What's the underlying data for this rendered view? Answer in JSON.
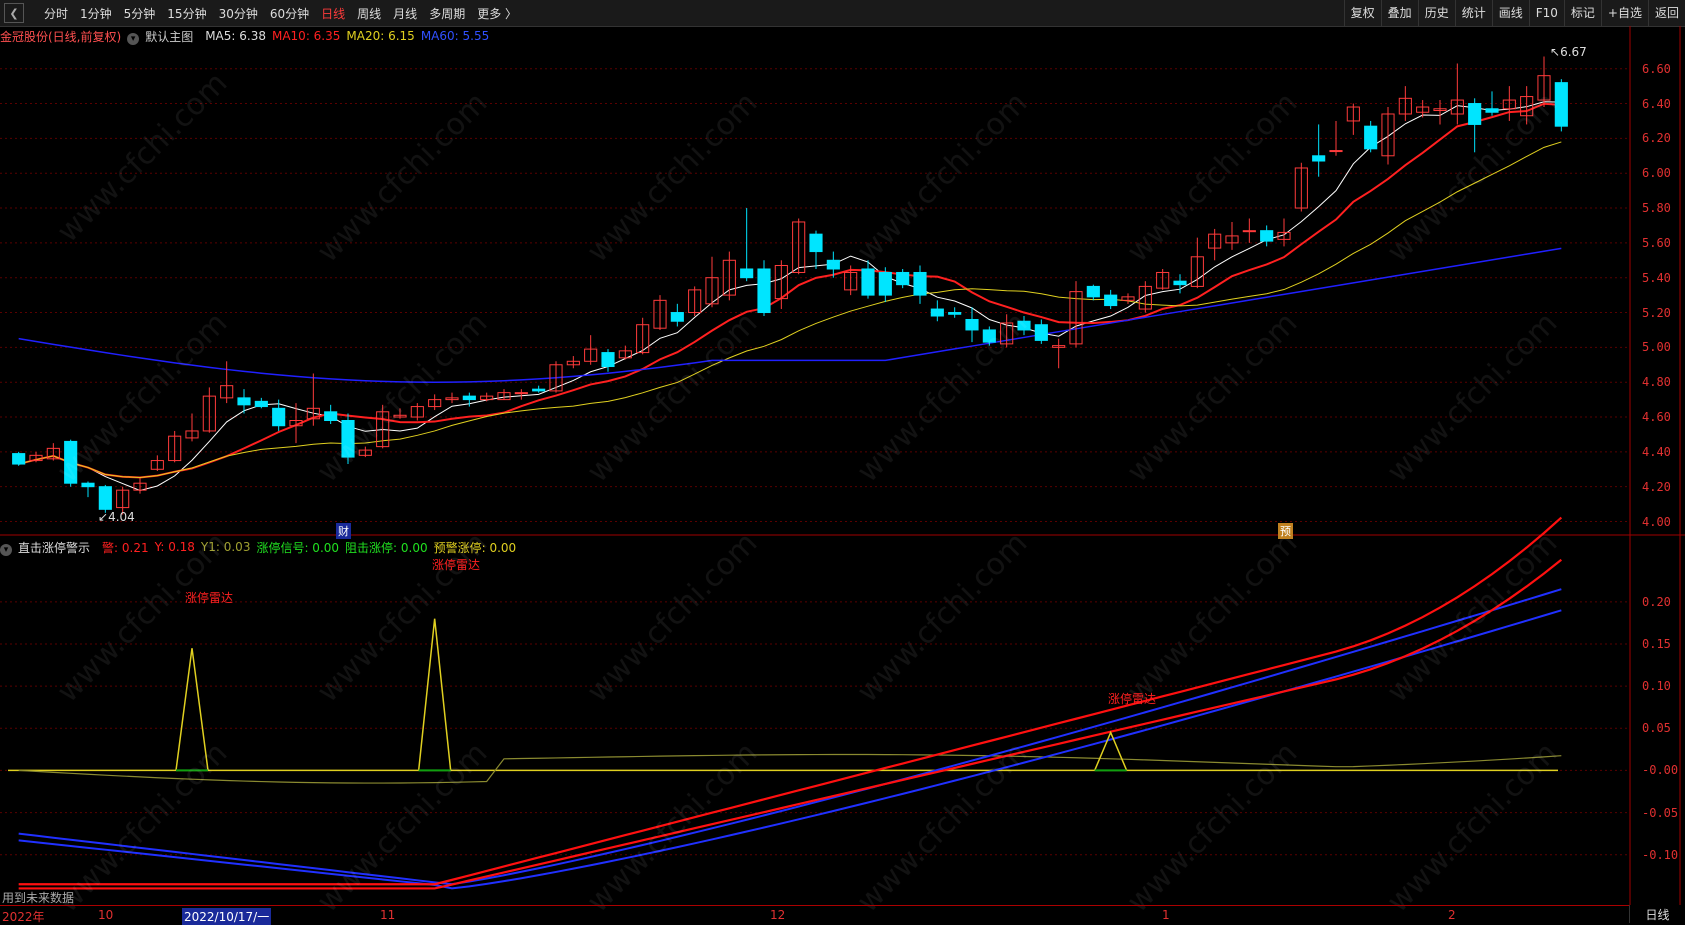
{
  "toolbar": {
    "periods": [
      "分时",
      "1分钟",
      "5分钟",
      "15分钟",
      "30分钟",
      "60分钟",
      "日线",
      "周线",
      "月线",
      "多周期",
      "更多 〉"
    ],
    "active_period": "日线",
    "right_buttons": [
      "复权",
      "叠加",
      "历史",
      "统计",
      "画线",
      "F10",
      "标记",
      "+自选",
      "返回"
    ]
  },
  "main_chart": {
    "stock_title": "金冠股份(日线,前复权)",
    "template": "默认主图",
    "ma5": "MA5: 6.38",
    "ma10": "MA10: 6.35",
    "ma20": "MA20: 6.15",
    "ma60": "MA60: 5.55",
    "high_label": "6.67",
    "low_label": "4.04",
    "marker_cai": "财",
    "marker_yu": "预",
    "y_ticks": [
      "6.60",
      "6.40",
      "6.20",
      "6.00",
      "5.80",
      "5.60",
      "5.40",
      "5.20",
      "5.00",
      "4.80",
      "4.60",
      "4.40",
      "4.20",
      "4.00"
    ]
  },
  "indicator": {
    "name": "直击涨停警示",
    "jing": "警: 0.21",
    "y": "Y: 0.18",
    "y1": "Y1: 0.03",
    "signal": "涨停信号: 0.00",
    "zuji": "阻击涨停: 0.00",
    "yujing": "预警涨停: 0.00",
    "radar_labels": [
      "涨停雷达",
      "涨停雷达",
      "涨停雷达"
    ],
    "y_ticks": [
      "0.20",
      "0.15",
      "0.10",
      "0.05",
      "-0.00",
      "-0.05",
      "-0.10"
    ]
  },
  "date_axis": {
    "labels": [
      "2022年",
      "10",
      "2022/10/17/一",
      "11",
      "12",
      "1",
      "2"
    ],
    "period": "日线"
  },
  "footer_note": "用到未来数据",
  "watermark": "www.cfchi.com",
  "colors": {
    "up": "#ff3b3b",
    "down": "#00e5ff",
    "ma5": "#ffffff",
    "ma10": "#ff2020",
    "ma20": "#e0d020",
    "ma60": "#2020ff"
  },
  "chart_data": {
    "type": "candlestick",
    "price_range": [
      3.95,
      6.7
    ],
    "candles": [
      [
        4.39,
        4.33,
        4.4,
        4.32
      ],
      [
        4.35,
        4.38,
        4.4,
        4.34
      ],
      [
        4.36,
        4.42,
        4.45,
        4.35
      ],
      [
        4.46,
        4.22,
        4.47,
        4.2
      ],
      [
        4.22,
        4.2,
        4.23,
        4.14
      ],
      [
        4.2,
        4.07,
        4.21,
        4.05
      ],
      [
        4.08,
        4.18,
        4.2,
        4.04
      ],
      [
        4.18,
        4.22,
        4.25,
        4.16
      ],
      [
        4.3,
        4.35,
        4.38,
        4.29
      ],
      [
        4.35,
        4.49,
        4.52,
        4.34
      ],
      [
        4.48,
        4.52,
        4.62,
        4.46
      ],
      [
        4.52,
        4.72,
        4.77,
        4.51
      ],
      [
        4.71,
        4.78,
        4.92,
        4.68
      ],
      [
        4.71,
        4.67,
        4.76,
        4.62
      ],
      [
        4.69,
        4.66,
        4.71,
        4.65
      ],
      [
        4.65,
        4.55,
        4.7,
        4.52
      ],
      [
        4.55,
        4.58,
        4.68,
        4.45
      ],
      [
        4.59,
        4.65,
        4.85,
        4.55
      ],
      [
        4.63,
        4.58,
        4.67,
        4.56
      ],
      [
        4.58,
        4.37,
        4.62,
        4.33
      ],
      [
        4.38,
        4.41,
        4.43,
        4.37
      ],
      [
        4.43,
        4.63,
        4.67,
        4.42
      ],
      [
        4.6,
        4.61,
        4.65,
        4.59
      ],
      [
        4.6,
        4.66,
        4.68,
        4.58
      ],
      [
        4.66,
        4.7,
        4.73,
        4.64
      ],
      [
        4.7,
        4.71,
        4.74,
        4.68
      ],
      [
        4.72,
        4.7,
        4.74,
        4.66
      ],
      [
        4.7,
        4.72,
        4.74,
        4.69
      ],
      [
        4.7,
        4.74,
        4.76,
        4.7
      ],
      [
        4.74,
        4.74,
        4.76,
        4.7
      ],
      [
        4.76,
        4.75,
        4.78,
        4.74
      ],
      [
        4.75,
        4.9,
        4.92,
        4.74
      ],
      [
        4.9,
        4.92,
        4.95,
        4.88
      ],
      [
        4.92,
        4.99,
        5.07,
        4.9
      ],
      [
        4.97,
        4.89,
        4.99,
        4.86
      ],
      [
        4.94,
        4.98,
        5.01,
        4.93
      ],
      [
        4.97,
        5.13,
        5.17,
        4.96
      ],
      [
        5.11,
        5.27,
        5.3,
        5.1
      ],
      [
        5.2,
        5.15,
        5.25,
        5.12
      ],
      [
        5.2,
        5.33,
        5.35,
        5.18
      ],
      [
        5.25,
        5.4,
        5.52,
        5.23
      ],
      [
        5.3,
        5.5,
        5.55,
        5.27
      ],
      [
        5.45,
        5.4,
        5.8,
        5.38
      ],
      [
        5.45,
        5.2,
        5.5,
        5.18
      ],
      [
        5.28,
        5.47,
        5.5,
        5.22
      ],
      [
        5.43,
        5.72,
        5.74,
        5.42
      ],
      [
        5.65,
        5.55,
        5.67,
        5.45
      ],
      [
        5.5,
        5.45,
        5.55,
        5.4
      ],
      [
        5.33,
        5.43,
        5.47,
        5.3
      ],
      [
        5.45,
        5.3,
        5.5,
        5.28
      ],
      [
        5.43,
        5.3,
        5.46,
        5.26
      ],
      [
        5.43,
        5.36,
        5.45,
        5.34
      ],
      [
        5.43,
        5.3,
        5.47,
        5.25
      ],
      [
        5.22,
        5.18,
        5.27,
        5.15
      ],
      [
        5.2,
        5.19,
        5.23,
        5.17
      ],
      [
        5.16,
        5.1,
        5.23,
        5.03
      ],
      [
        5.1,
        5.03,
        5.12,
        5.01
      ],
      [
        5.02,
        5.14,
        5.19,
        5.0
      ],
      [
        5.15,
        5.1,
        5.18,
        5.07
      ],
      [
        5.13,
        5.04,
        5.16,
        5.02
      ],
      [
        5.0,
        5.01,
        5.05,
        4.88
      ],
      [
        5.02,
        5.32,
        5.38,
        5.0
      ],
      [
        5.35,
        5.29,
        5.36,
        5.27
      ],
      [
        5.3,
        5.24,
        5.33,
        5.22
      ],
      [
        5.27,
        5.29,
        5.31,
        5.25
      ],
      [
        5.22,
        5.35,
        5.38,
        5.2
      ],
      [
        5.34,
        5.43,
        5.45,
        5.33
      ],
      [
        5.38,
        5.36,
        5.42,
        5.31
      ],
      [
        5.35,
        5.52,
        5.63,
        5.34
      ],
      [
        5.57,
        5.65,
        5.68,
        5.5
      ],
      [
        5.6,
        5.64,
        5.72,
        5.56
      ],
      [
        5.67,
        5.67,
        5.74,
        5.6
      ],
      [
        5.67,
        5.61,
        5.7,
        5.58
      ],
      [
        5.62,
        5.66,
        5.74,
        5.58
      ],
      [
        5.8,
        6.03,
        6.06,
        5.78
      ],
      [
        6.1,
        6.07,
        6.28,
        5.98
      ],
      [
        6.13,
        6.13,
        6.3,
        6.1
      ],
      [
        6.3,
        6.38,
        6.4,
        6.22
      ],
      [
        6.27,
        6.14,
        6.3,
        6.12
      ],
      [
        6.1,
        6.34,
        6.38,
        6.05
      ],
      [
        6.34,
        6.43,
        6.5,
        6.3
      ],
      [
        6.35,
        6.38,
        6.42,
        6.32
      ],
      [
        6.36,
        6.37,
        6.42,
        6.28
      ],
      [
        6.34,
        6.42,
        6.63,
        6.28
      ],
      [
        6.4,
        6.28,
        6.43,
        6.12
      ],
      [
        6.37,
        6.35,
        6.47,
        6.33
      ],
      [
        6.37,
        6.42,
        6.5,
        6.3
      ],
      [
        6.33,
        6.44,
        6.5,
        6.28
      ],
      [
        6.42,
        6.56,
        6.67,
        6.38
      ],
      [
        6.52,
        6.27,
        6.54,
        6.24
      ]
    ]
  }
}
